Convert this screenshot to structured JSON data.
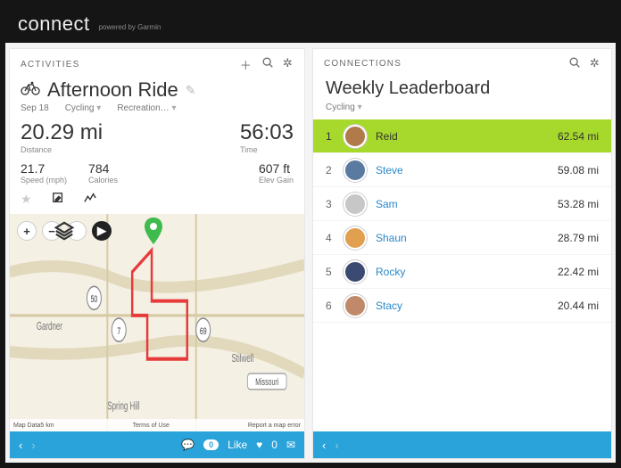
{
  "brand": {
    "name": "connect",
    "tagline": "powered by Garmin"
  },
  "activities": {
    "header": "ACTIVITIES",
    "title": "Afternoon Ride",
    "date": "Sep 18",
    "sport": "Cycling",
    "category": "Recreation…",
    "distance_value": "20.29 mi",
    "distance_label": "Distance",
    "time_value": "56:03",
    "time_label": "Time",
    "speed_value": "21.7",
    "speed_label": "Speed (mph)",
    "calories_value": "784",
    "calories_label": "Calories",
    "elev_value": "607 ft",
    "elev_label": "Elev Gain",
    "map_footer_left": "Map Data",
    "map_footer_scale": "5 km",
    "map_footer_terms": "Terms of Use",
    "map_footer_report": "Report a map error",
    "comments": "0",
    "like_label": "Like",
    "likes": "0",
    "places": [
      "Gardner",
      "Spring Hill",
      "Stilwell",
      "Missouri"
    ],
    "roads": [
      "50",
      "7",
      "69"
    ]
  },
  "connections": {
    "header": "CONNECTIONS",
    "title": "Weekly Leaderboard",
    "filter": "Cycling",
    "rows": [
      {
        "rank": "1",
        "name": "Reid",
        "dist": "62.54 mi",
        "top": true
      },
      {
        "rank": "2",
        "name": "Steve",
        "dist": "59.08 mi"
      },
      {
        "rank": "3",
        "name": "Sam",
        "dist": "53.28 mi"
      },
      {
        "rank": "4",
        "name": "Shaun",
        "dist": "28.79 mi"
      },
      {
        "rank": "5",
        "name": "Rocky",
        "dist": "22.42 mi"
      },
      {
        "rank": "6",
        "name": "Stacy",
        "dist": "20.44 mi"
      }
    ]
  },
  "avatar_colors": [
    "#b07a4a",
    "#5a7aa0",
    "#c7c7c7",
    "#e0a050",
    "#3a4a70",
    "#c08a6a"
  ]
}
